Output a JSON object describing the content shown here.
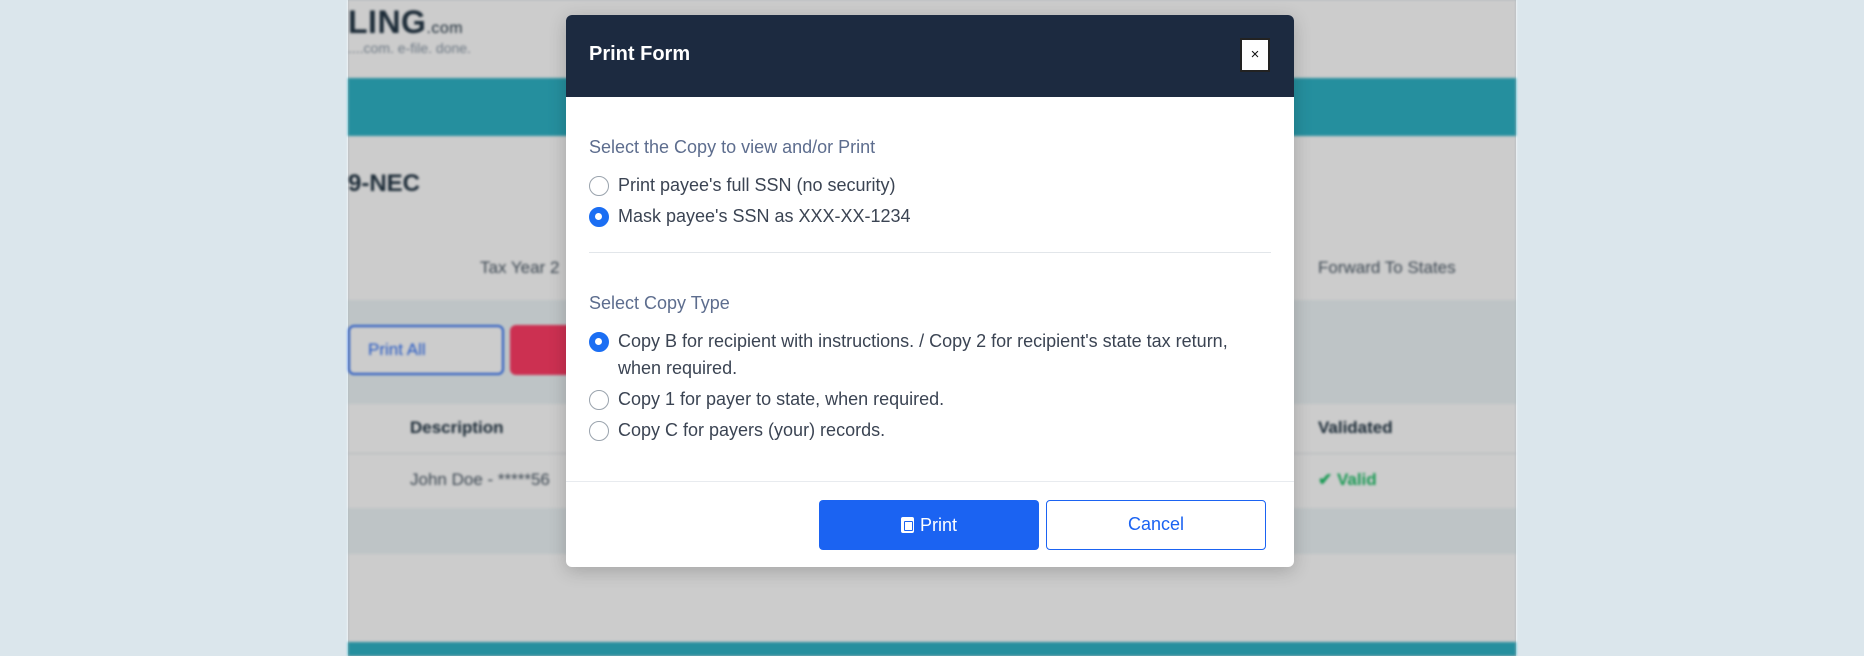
{
  "background": {
    "logo_text": "LING",
    "logo_tld": ".com",
    "tagline": "....com. e-file. done.",
    "page_heading": "9-NEC",
    "tax_year_label": "Tax Year 2",
    "forward_label": "Forward To States",
    "print_all_label": "Print All",
    "table": {
      "headers": [
        "Description",
        "Validated"
      ],
      "rows": [
        {
          "description": "John Doe - *****56",
          "validated": "✔ Valid"
        }
      ]
    }
  },
  "modal": {
    "title": "Print Form",
    "close_label": "×",
    "ssn_section": {
      "label": "Select the Copy to view and/or Print",
      "options": [
        {
          "label": "Print payee's full SSN (no security)",
          "checked": false
        },
        {
          "label": "Mask payee's SSN as XXX-XX-1234",
          "checked": true
        }
      ]
    },
    "copy_section": {
      "label": "Select Copy Type",
      "options": [
        {
          "label": "Copy B for recipient with instructions. / Copy 2 for recipient's state tax return, when required.",
          "checked": true
        },
        {
          "label": "Copy 1 for payer to state, when required.",
          "checked": false
        },
        {
          "label": "Copy C for payers (your) records.",
          "checked": false
        }
      ]
    },
    "print_label": "Print",
    "cancel_label": "Cancel"
  },
  "colors": {
    "header_bg": "#1c2a40",
    "primary": "#1b63f2",
    "teal": "#2fb3c6"
  }
}
